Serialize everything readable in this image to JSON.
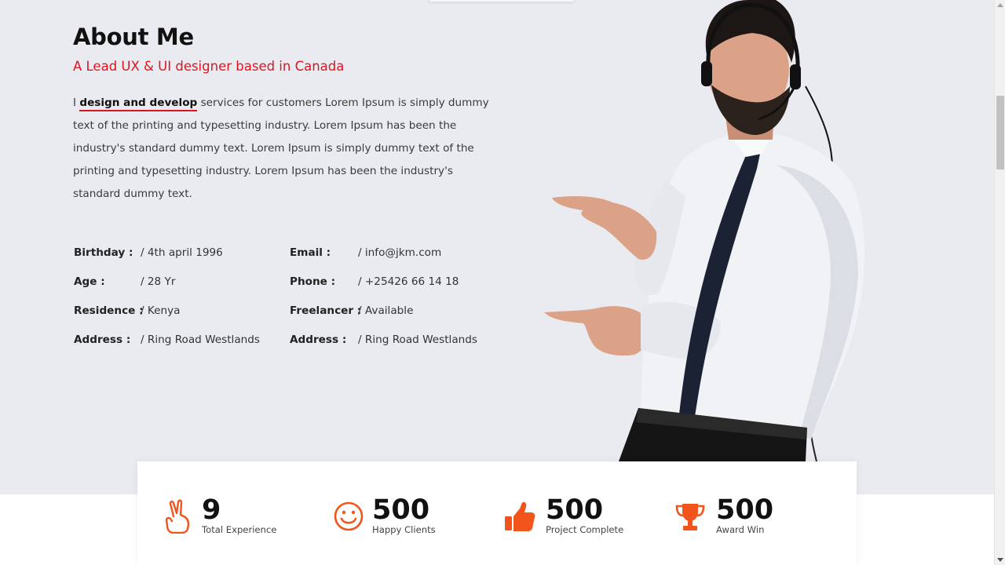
{
  "about": {
    "title": "About Me",
    "subtitle": "A Lead UX & UI designer based in Canada",
    "paragraph": {
      "prefix": "I ",
      "highlight": "design and develop",
      "rest": " services for customers Lorem Ipsum is simply dummy text of the printing and typesetting industry. Lorem Ipsum has been the industry's standard dummy text. Lorem Ipsum is simply dummy text of the printing and typesetting industry. Lorem Ipsum has been the industry's standard dummy text."
    }
  },
  "info": {
    "left": [
      {
        "key": "Birthday :",
        "value": "/ 4th april 1996"
      },
      {
        "key": "Age :",
        "value": "/ 28 Yr"
      },
      {
        "key": "Residence :",
        "value": "/ Kenya"
      },
      {
        "key": "Address :",
        "value": "/ Ring Road Westlands"
      }
    ],
    "right": [
      {
        "key": "Email :",
        "value": "/ info@jkm.com"
      },
      {
        "key": "Phone :",
        "value": "/ +25426 66 14 18"
      },
      {
        "key": "Freelancer :",
        "value": "/ Available"
      },
      {
        "key": "Address :",
        "value": "/ Ring Road Westlands"
      }
    ]
  },
  "stats": [
    {
      "number": "9",
      "label": "Total Experience",
      "icon": "peace-hand-icon"
    },
    {
      "number": "500",
      "label": "Happy Clients",
      "icon": "smiley-icon"
    },
    {
      "number": "500",
      "label": "Project Complete",
      "icon": "thumbs-up-icon"
    },
    {
      "number": "500",
      "label": "Award Win",
      "icon": "trophy-icon"
    }
  ],
  "colors": {
    "accent": "#e0141e",
    "icon_orange": "#f2541b",
    "section_bg": "#e9ebf0"
  }
}
